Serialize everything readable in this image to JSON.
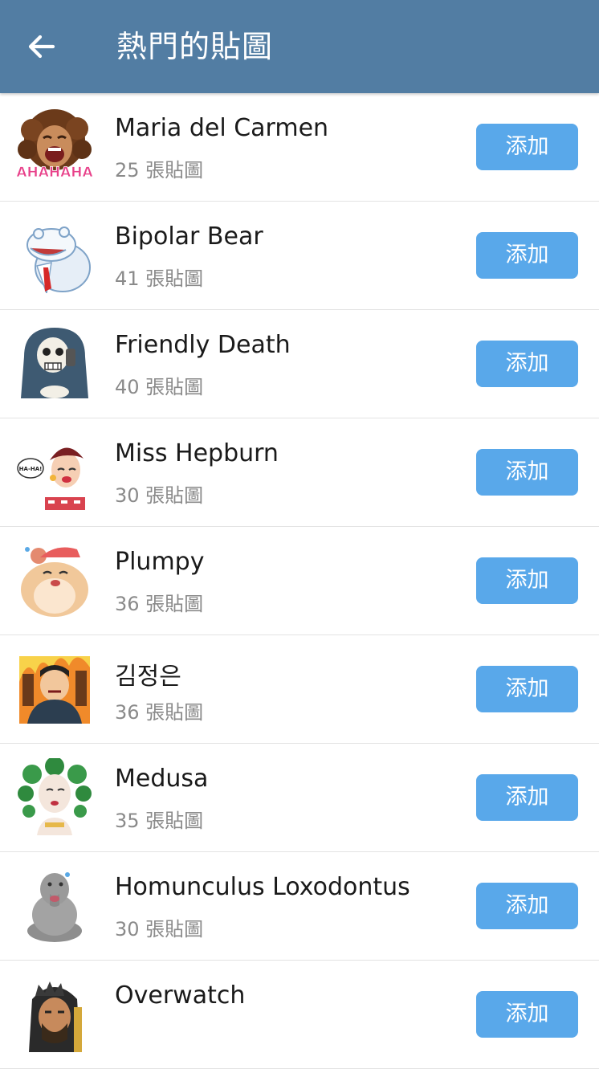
{
  "header": {
    "title": "熱門的貼圖",
    "back_icon": "arrow-left-icon",
    "color": "#527da3"
  },
  "accent": "#59a8ea",
  "sticker_sets": [
    {
      "name": "Maria del Carmen",
      "count": "25 張貼圖",
      "button": "添加",
      "icon": "laughing-woman-sticker",
      "thumb_text": "AHAHAHA"
    },
    {
      "name": "Bipolar Bear",
      "count": "41 張貼圖",
      "button": "添加",
      "icon": "polar-bear-sticker"
    },
    {
      "name": "Friendly Death",
      "count": "40 張貼圖",
      "button": "添加",
      "icon": "skeleton-sticker"
    },
    {
      "name": "Miss Hepburn",
      "count": "30 張貼圖",
      "button": "添加",
      "icon": "retro-lady-sticker",
      "thumb_text": "HA-HA!"
    },
    {
      "name": "Plumpy",
      "count": "36 張貼圖",
      "button": "添加",
      "icon": "hamster-sticker"
    },
    {
      "name": "김정은",
      "count": "36 張貼圖",
      "button": "添加",
      "icon": "man-fire-sticker"
    },
    {
      "name": "Medusa",
      "count": "35 張貼圖",
      "button": "添加",
      "icon": "medusa-sticker"
    },
    {
      "name": "Homunculus Loxodontus",
      "count": "30 張貼圖",
      "button": "添加",
      "icon": "elephant-creature-sticker"
    },
    {
      "name": "Overwatch",
      "count": "",
      "button": "添加",
      "icon": "overwatch-hero-sticker"
    }
  ]
}
